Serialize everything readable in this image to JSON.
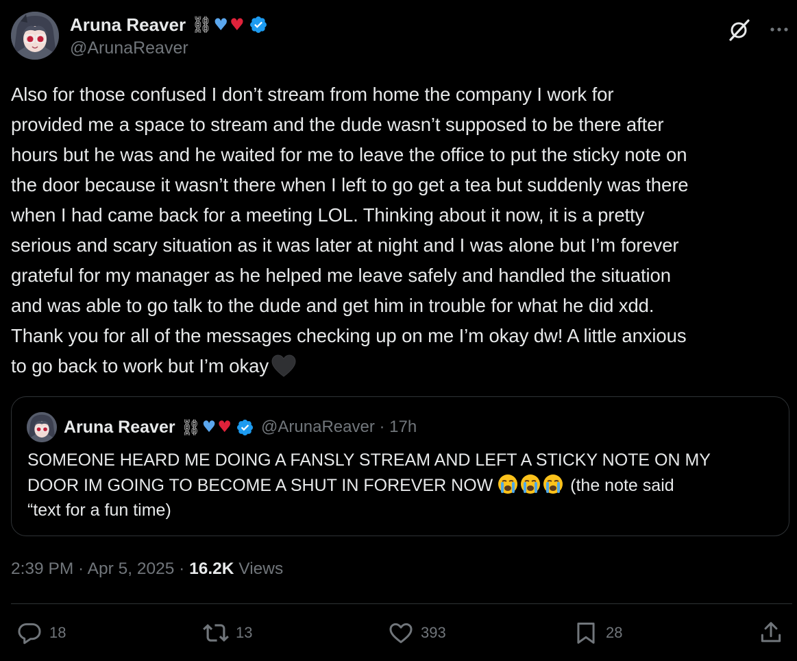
{
  "author": {
    "display_name": "Aruna Reaver",
    "handle": "@ArunaReaver",
    "name_emoji": {
      "chain": "⛓",
      "blue_heart": "♥",
      "red_heart": "♥"
    },
    "verified_icon": "verified-badge-icon",
    "avatar_icon": "anime-avatar"
  },
  "header_actions": {
    "grok_icon": "grok-icon",
    "more_icon": "more-icon"
  },
  "tweet": {
    "lines": [
      "Also for those confused I don’t stream from home the company I work for",
      "provided me a space to stream and the dude wasn’t supposed to be there after",
      "hours but he was and he waited for me to leave the office to put the sticky note on",
      "the door because it wasn’t there when I left to go get a tea but suddenly was there",
      "when I had came back for a meeting LOL. Thinking about it now, it is a pretty",
      "serious and scary situation as it was later at night and I was alone but I’m forever",
      "grateful for my manager as he helped me leave safely and handled the situation",
      "and was able to go talk to the dude and get him in trouble for what he did xdd.",
      "Thank you for all of the messages checking up on me I’m okay dw! A little anxious",
      "to go back to work but I’m okay"
    ],
    "trailing_emoji": "black-heart-icon"
  },
  "quote": {
    "display_name": "Aruna Reaver",
    "handle_time": "@ArunaReaver · 17h",
    "lines": [
      "SOMEONE HEARD ME DOING A FANSLY STREAM AND LEFT A STICKY NOTE ON MY",
      "DOOR IM GOING TO BECOME A SHUT IN FOREVER NOW",
      "(the note said",
      "“text for a fun time)"
    ],
    "crying_emoji_count": 3
  },
  "meta": {
    "timestamp": "2:39 PM · Apr 5, 2025 · ",
    "views_count": "16.2K",
    "views_label": " Views"
  },
  "actions": {
    "replies": "18",
    "reposts": "13",
    "likes": "393",
    "bookmarks": "28"
  },
  "colors": {
    "background": "#000000",
    "text_primary": "#e7e9ea",
    "text_secondary": "#71767b",
    "border": "#2f3336",
    "verified_blue": "#1d9bf0"
  }
}
